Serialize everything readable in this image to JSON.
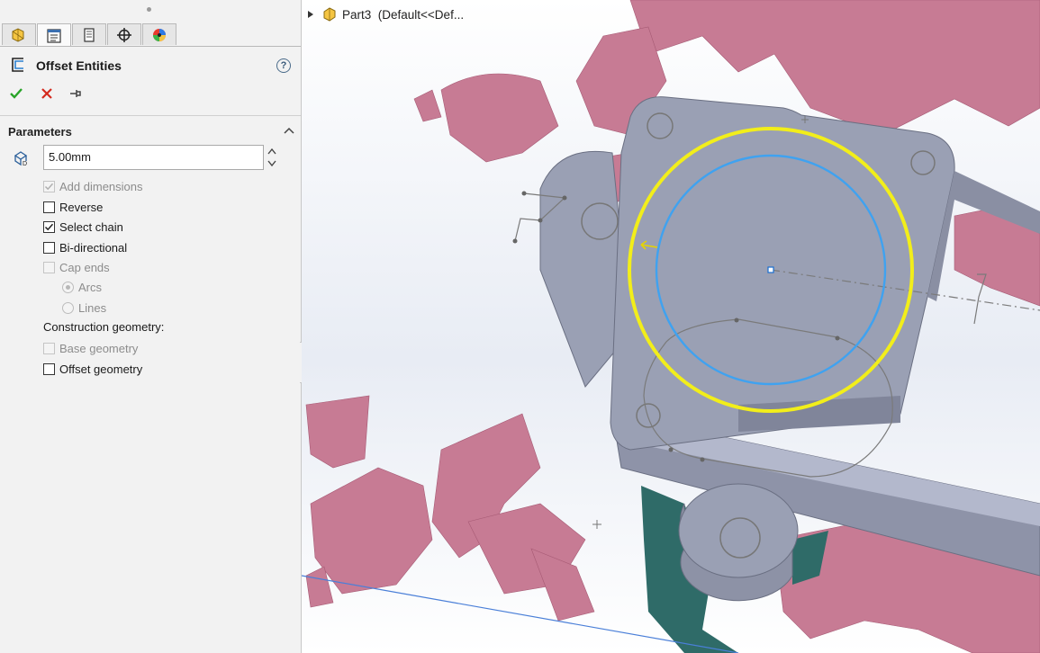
{
  "property_manager": {
    "tabs": [
      {
        "name": "feature-manager",
        "icon": "feature-tree-icon"
      },
      {
        "name": "property-manager",
        "icon": "property-manager-icon"
      },
      {
        "name": "configuration-manager",
        "icon": "configuration-manager-icon"
      },
      {
        "name": "dimxpert-manager",
        "icon": "crosshair-icon"
      },
      {
        "name": "display-manager",
        "icon": "appearance-ball-icon"
      }
    ],
    "active_tab": "property-manager",
    "title": "Offset Entities",
    "help": "?",
    "actions": {
      "ok": "ok-check-icon",
      "cancel": "cancel-x-icon",
      "pin": "pushpin-icon"
    },
    "parameters": {
      "label": "Parameters",
      "distance": "5.00mm",
      "options": [
        {
          "label": "Add dimensions",
          "checked": true,
          "disabled": true
        },
        {
          "label": "Reverse",
          "checked": false,
          "disabled": false
        },
        {
          "label": "Select chain",
          "checked": true,
          "disabled": false
        },
        {
          "label": "Bi-directional",
          "checked": false,
          "disabled": false
        },
        {
          "label": "Cap ends",
          "checked": false,
          "disabled": true
        }
      ],
      "cap_end_types": [
        {
          "label": "Arcs",
          "selected": true,
          "disabled": true
        },
        {
          "label": "Lines",
          "selected": false,
          "disabled": true
        }
      ],
      "construction_label": "Construction geometry:",
      "construction": [
        {
          "label": "Base geometry",
          "checked": false,
          "disabled": true
        },
        {
          "label": "Offset geometry",
          "checked": false,
          "disabled": false
        }
      ]
    }
  },
  "viewport": {
    "breadcrumb": "Part3  (Default<<Def...",
    "colors": {
      "surface": "#c77b94",
      "body": "#9aa0b4",
      "yellow": "#f2ee1a",
      "blue": "#3fa2f0"
    }
  }
}
